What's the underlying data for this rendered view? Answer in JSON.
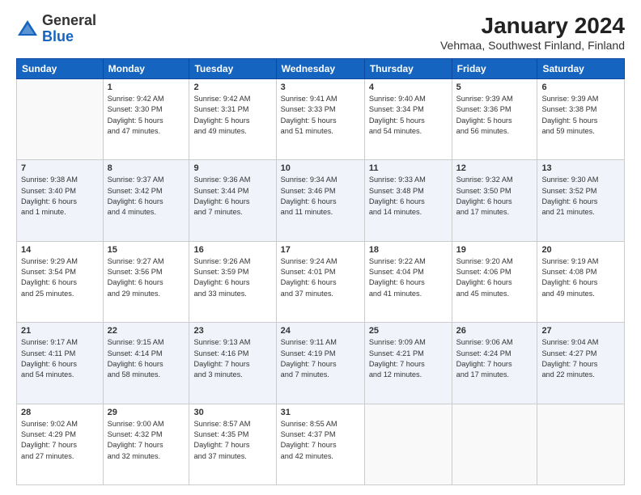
{
  "header": {
    "logo_general": "General",
    "logo_blue": "Blue",
    "title": "January 2024",
    "subtitle": "Vehmaa, Southwest Finland, Finland"
  },
  "weekdays": [
    "Sunday",
    "Monday",
    "Tuesday",
    "Wednesday",
    "Thursday",
    "Friday",
    "Saturday"
  ],
  "weeks": [
    [
      {
        "day": "",
        "info": ""
      },
      {
        "day": "1",
        "info": "Sunrise: 9:42 AM\nSunset: 3:30 PM\nDaylight: 5 hours\nand 47 minutes."
      },
      {
        "day": "2",
        "info": "Sunrise: 9:42 AM\nSunset: 3:31 PM\nDaylight: 5 hours\nand 49 minutes."
      },
      {
        "day": "3",
        "info": "Sunrise: 9:41 AM\nSunset: 3:33 PM\nDaylight: 5 hours\nand 51 minutes."
      },
      {
        "day": "4",
        "info": "Sunrise: 9:40 AM\nSunset: 3:34 PM\nDaylight: 5 hours\nand 54 minutes."
      },
      {
        "day": "5",
        "info": "Sunrise: 9:39 AM\nSunset: 3:36 PM\nDaylight: 5 hours\nand 56 minutes."
      },
      {
        "day": "6",
        "info": "Sunrise: 9:39 AM\nSunset: 3:38 PM\nDaylight: 5 hours\nand 59 minutes."
      }
    ],
    [
      {
        "day": "7",
        "info": "Sunrise: 9:38 AM\nSunset: 3:40 PM\nDaylight: 6 hours\nand 1 minute."
      },
      {
        "day": "8",
        "info": "Sunrise: 9:37 AM\nSunset: 3:42 PM\nDaylight: 6 hours\nand 4 minutes."
      },
      {
        "day": "9",
        "info": "Sunrise: 9:36 AM\nSunset: 3:44 PM\nDaylight: 6 hours\nand 7 minutes."
      },
      {
        "day": "10",
        "info": "Sunrise: 9:34 AM\nSunset: 3:46 PM\nDaylight: 6 hours\nand 11 minutes."
      },
      {
        "day": "11",
        "info": "Sunrise: 9:33 AM\nSunset: 3:48 PM\nDaylight: 6 hours\nand 14 minutes."
      },
      {
        "day": "12",
        "info": "Sunrise: 9:32 AM\nSunset: 3:50 PM\nDaylight: 6 hours\nand 17 minutes."
      },
      {
        "day": "13",
        "info": "Sunrise: 9:30 AM\nSunset: 3:52 PM\nDaylight: 6 hours\nand 21 minutes."
      }
    ],
    [
      {
        "day": "14",
        "info": "Sunrise: 9:29 AM\nSunset: 3:54 PM\nDaylight: 6 hours\nand 25 minutes."
      },
      {
        "day": "15",
        "info": "Sunrise: 9:27 AM\nSunset: 3:56 PM\nDaylight: 6 hours\nand 29 minutes."
      },
      {
        "day": "16",
        "info": "Sunrise: 9:26 AM\nSunset: 3:59 PM\nDaylight: 6 hours\nand 33 minutes."
      },
      {
        "day": "17",
        "info": "Sunrise: 9:24 AM\nSunset: 4:01 PM\nDaylight: 6 hours\nand 37 minutes."
      },
      {
        "day": "18",
        "info": "Sunrise: 9:22 AM\nSunset: 4:04 PM\nDaylight: 6 hours\nand 41 minutes."
      },
      {
        "day": "19",
        "info": "Sunrise: 9:20 AM\nSunset: 4:06 PM\nDaylight: 6 hours\nand 45 minutes."
      },
      {
        "day": "20",
        "info": "Sunrise: 9:19 AM\nSunset: 4:08 PM\nDaylight: 6 hours\nand 49 minutes."
      }
    ],
    [
      {
        "day": "21",
        "info": "Sunrise: 9:17 AM\nSunset: 4:11 PM\nDaylight: 6 hours\nand 54 minutes."
      },
      {
        "day": "22",
        "info": "Sunrise: 9:15 AM\nSunset: 4:14 PM\nDaylight: 6 hours\nand 58 minutes."
      },
      {
        "day": "23",
        "info": "Sunrise: 9:13 AM\nSunset: 4:16 PM\nDaylight: 7 hours\nand 3 minutes."
      },
      {
        "day": "24",
        "info": "Sunrise: 9:11 AM\nSunset: 4:19 PM\nDaylight: 7 hours\nand 7 minutes."
      },
      {
        "day": "25",
        "info": "Sunrise: 9:09 AM\nSunset: 4:21 PM\nDaylight: 7 hours\nand 12 minutes."
      },
      {
        "day": "26",
        "info": "Sunrise: 9:06 AM\nSunset: 4:24 PM\nDaylight: 7 hours\nand 17 minutes."
      },
      {
        "day": "27",
        "info": "Sunrise: 9:04 AM\nSunset: 4:27 PM\nDaylight: 7 hours\nand 22 minutes."
      }
    ],
    [
      {
        "day": "28",
        "info": "Sunrise: 9:02 AM\nSunset: 4:29 PM\nDaylight: 7 hours\nand 27 minutes."
      },
      {
        "day": "29",
        "info": "Sunrise: 9:00 AM\nSunset: 4:32 PM\nDaylight: 7 hours\nand 32 minutes."
      },
      {
        "day": "30",
        "info": "Sunrise: 8:57 AM\nSunset: 4:35 PM\nDaylight: 7 hours\nand 37 minutes."
      },
      {
        "day": "31",
        "info": "Sunrise: 8:55 AM\nSunset: 4:37 PM\nDaylight: 7 hours\nand 42 minutes."
      },
      {
        "day": "",
        "info": ""
      },
      {
        "day": "",
        "info": ""
      },
      {
        "day": "",
        "info": ""
      }
    ]
  ]
}
